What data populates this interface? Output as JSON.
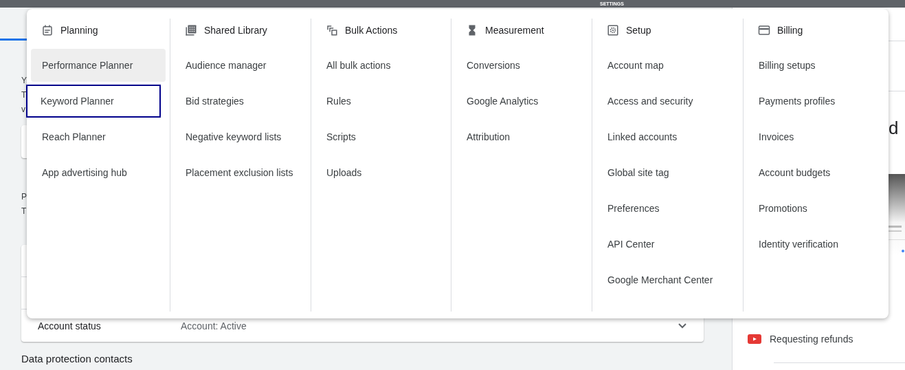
{
  "top_bar": {
    "label": "SETTINGS"
  },
  "page": {
    "fragments": [
      "Y",
      "T",
      "v"
    ],
    "section_fragments": [
      "P",
      "T"
    ],
    "status_row": {
      "label": "Account status",
      "value": "Account: Active"
    },
    "next_heading": "Data protection contacts"
  },
  "side_panel": {
    "title_fragment": "d",
    "links": [
      {
        "label": "Requesting refunds"
      }
    ]
  },
  "menu": {
    "columns": [
      {
        "title": "Planning",
        "items": [
          {
            "label": "Performance Planner",
            "hovered": true,
            "focused": false
          },
          {
            "label": "Keyword Planner",
            "hovered": false,
            "focused": true
          },
          {
            "label": "Reach Planner",
            "hovered": false,
            "focused": false
          },
          {
            "label": "App advertising hub",
            "hovered": false,
            "focused": false
          }
        ]
      },
      {
        "title": "Shared Library",
        "items": [
          {
            "label": "Audience manager",
            "hovered": false,
            "focused": false
          },
          {
            "label": "Bid strategies",
            "hovered": false,
            "focused": false
          },
          {
            "label": "Negative keyword lists",
            "hovered": false,
            "focused": false
          },
          {
            "label": "Placement exclusion lists",
            "hovered": false,
            "focused": false
          }
        ]
      },
      {
        "title": "Bulk Actions",
        "items": [
          {
            "label": "All bulk actions",
            "hovered": false,
            "focused": false
          },
          {
            "label": "Rules",
            "hovered": false,
            "focused": false
          },
          {
            "label": "Scripts",
            "hovered": false,
            "focused": false
          },
          {
            "label": "Uploads",
            "hovered": false,
            "focused": false
          }
        ]
      },
      {
        "title": "Measurement",
        "items": [
          {
            "label": "Conversions",
            "hovered": false,
            "focused": false
          },
          {
            "label": "Google Analytics",
            "hovered": false,
            "focused": false
          },
          {
            "label": "Attribution",
            "hovered": false,
            "focused": false
          }
        ]
      },
      {
        "title": "Setup",
        "items": [
          {
            "label": "Account map",
            "hovered": false,
            "focused": false
          },
          {
            "label": "Access and security",
            "hovered": false,
            "focused": false
          },
          {
            "label": "Linked accounts",
            "hovered": false,
            "focused": false
          },
          {
            "label": "Global site tag",
            "hovered": false,
            "focused": false
          },
          {
            "label": "Preferences",
            "hovered": false,
            "focused": false
          },
          {
            "label": "API Center",
            "hovered": false,
            "focused": false
          },
          {
            "label": "Google Merchant Center",
            "hovered": false,
            "focused": false
          }
        ]
      },
      {
        "title": "Billing",
        "items": [
          {
            "label": "Billing setups",
            "hovered": false,
            "focused": false
          },
          {
            "label": "Payments profiles",
            "hovered": false,
            "focused": false
          },
          {
            "label": "Invoices",
            "hovered": false,
            "focused": false
          },
          {
            "label": "Account budgets",
            "hovered": false,
            "focused": false
          },
          {
            "label": "Promotions",
            "hovered": false,
            "focused": false
          },
          {
            "label": "Identity verification",
            "hovered": false,
            "focused": false
          }
        ]
      }
    ]
  }
}
